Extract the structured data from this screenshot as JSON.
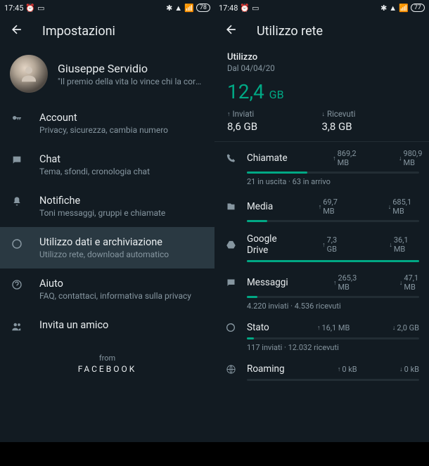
{
  "left": {
    "statusTime": "17:45",
    "battery": "78",
    "title": "Impostazioni",
    "profile": {
      "name": "Giuseppe Servidio",
      "status": "\"Il premio della vita lo vince chi la cors…"
    },
    "items": [
      {
        "icon": "key",
        "title": "Account",
        "sub": "Privacy, sicurezza, cambia numero"
      },
      {
        "icon": "chat",
        "title": "Chat",
        "sub": "Tema, sfondi, cronologia chat"
      },
      {
        "icon": "bell",
        "title": "Notifiche",
        "sub": "Toni messaggi, gruppi e chiamate"
      },
      {
        "icon": "data",
        "title": "Utilizzo dati e archiviazione",
        "sub": "Utilizzo rete, download automatico",
        "selected": true
      },
      {
        "icon": "help",
        "title": "Aiuto",
        "sub": "FAQ, contattaci, informativa sulla privacy"
      },
      {
        "icon": "invite",
        "title": "Invita un amico"
      }
    ],
    "from": "from",
    "brand": "FACEBOOK"
  },
  "right": {
    "statusTime": "17:48",
    "battery": "77",
    "title": "Utilizzo rete",
    "usageLabel": "Utilizzo",
    "usageDate": "Dal 04/04/20",
    "totalValue": "12,4",
    "totalUnit": "GB",
    "sentLabel": "Inviati",
    "sentValue": "8,6 GB",
    "recvLabel": "Ricevuti",
    "recvValue": "3,8 GB",
    "cats": [
      {
        "icon": "phone",
        "name": "Chiamate",
        "up": "869,2 MB",
        "down": "980,9 MB",
        "bar": 35,
        "sub": "21 in uscita · 63 in arrivo"
      },
      {
        "icon": "media",
        "name": "Media",
        "up": "69,7 MB",
        "down": "685,1 MB",
        "bar": 12
      },
      {
        "icon": "drive",
        "name": "Google Drive",
        "up": "7,3 GB",
        "down": "36,1 MB",
        "bar": 100
      },
      {
        "icon": "msg",
        "name": "Messaggi",
        "up": "265,3 MB",
        "down": "47,1 MB",
        "bar": 6,
        "sub": "4.220 inviati · 4.536 ricevuti"
      },
      {
        "icon": "status",
        "name": "Stato",
        "up": "16,1 MB",
        "down": "2,0 GB",
        "bar": 4,
        "sub": "117 inviati · 12.032 ricevuti"
      },
      {
        "icon": "globe",
        "name": "Roaming",
        "up": "0 kB",
        "down": "0 kB",
        "bar": 0
      }
    ]
  }
}
